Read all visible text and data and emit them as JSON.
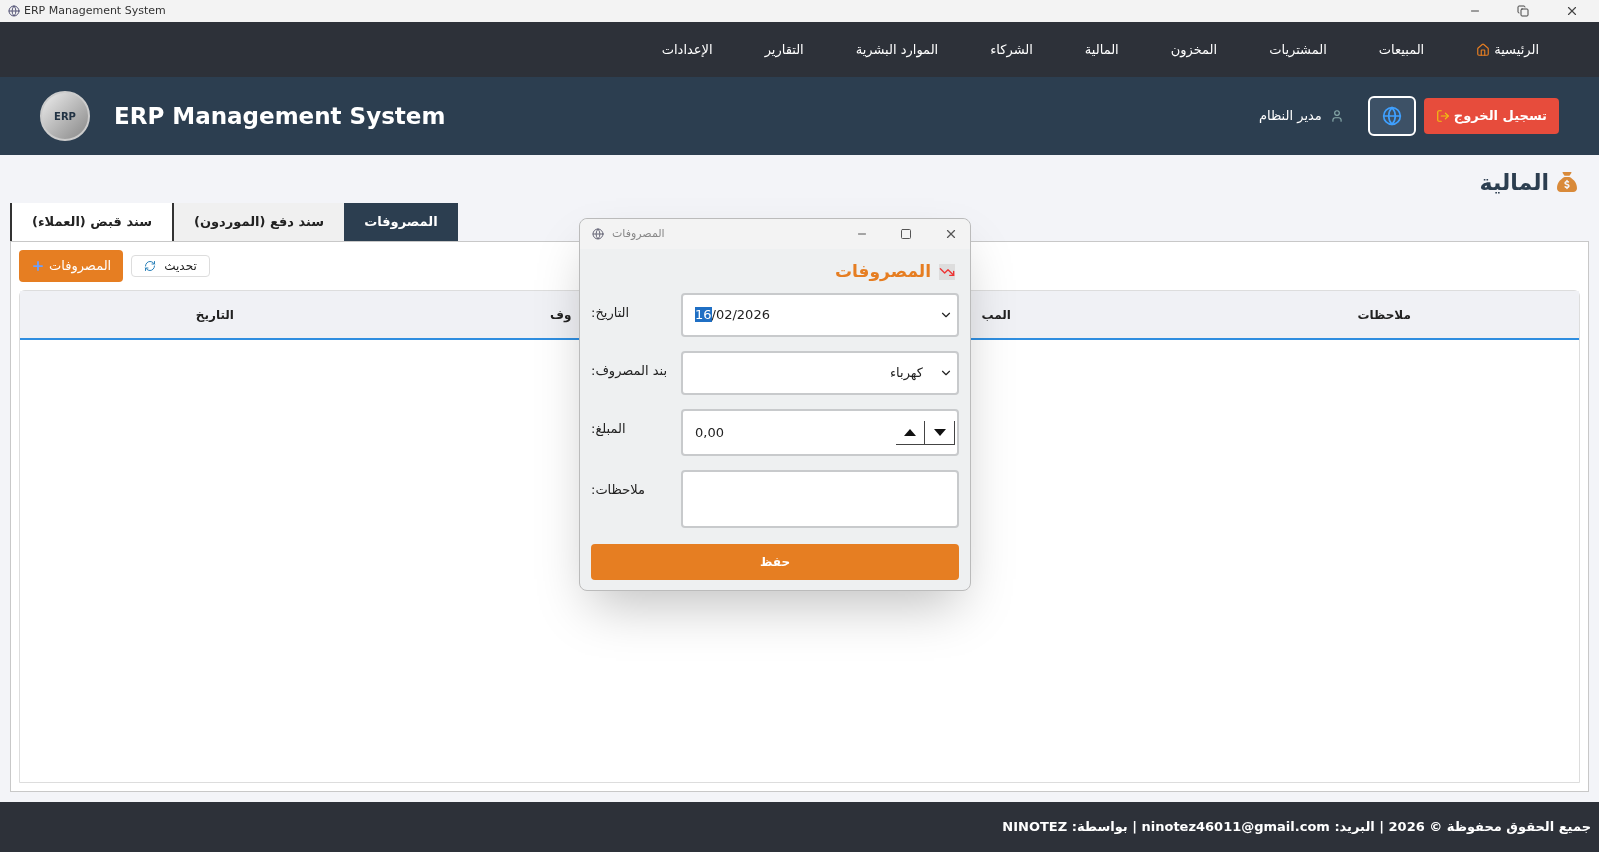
{
  "window": {
    "title": "ERP Management System"
  },
  "nav": [
    {
      "label": "الرئيسية"
    },
    {
      "label": "المبيعات"
    },
    {
      "label": "المشتريات"
    },
    {
      "label": "المخزون"
    },
    {
      "label": "المالية"
    },
    {
      "label": "الشركاء"
    },
    {
      "label": "الموارد البشرية"
    },
    {
      "label": "التقارير"
    },
    {
      "label": "الإعدادات"
    }
  ],
  "header": {
    "logo_text": "ERP",
    "title": "ERP Management System",
    "user": "مدير النظام",
    "logout": "تسجيل الخروج"
  },
  "page_title": "المالية",
  "tabs": [
    {
      "label": "المصروفات",
      "selected": true
    },
    {
      "label": "سند دفع (الموردون)",
      "selected": false
    },
    {
      "label": "سند قبض (العملاء)",
      "selected": false
    }
  ],
  "toolbar": {
    "add": "المصروفات",
    "refresh": "تحديث"
  },
  "table": {
    "columns": [
      "ملاحظات",
      "المب",
      "وف",
      "التاريخ"
    ]
  },
  "dialog": {
    "title": "المصروفات",
    "heading": "المصروفات",
    "fields": [
      {
        "kind": "date",
        "label": "التاريخ:",
        "value_selected": "16",
        "value_rest": "/02/2026"
      },
      {
        "kind": "select",
        "label": "بند المصروف:",
        "value": "كهرباء"
      },
      {
        "kind": "spin",
        "label": "المبلغ:",
        "value": "0,00"
      },
      {
        "kind": "textarea",
        "label": "ملاحظات:"
      }
    ],
    "save": "حفظ"
  },
  "footer": "جميع الحقوق محفوظة © 2026 | البريد: ninotez46011@gmail.com | بواسطة: NINOTEZ"
}
